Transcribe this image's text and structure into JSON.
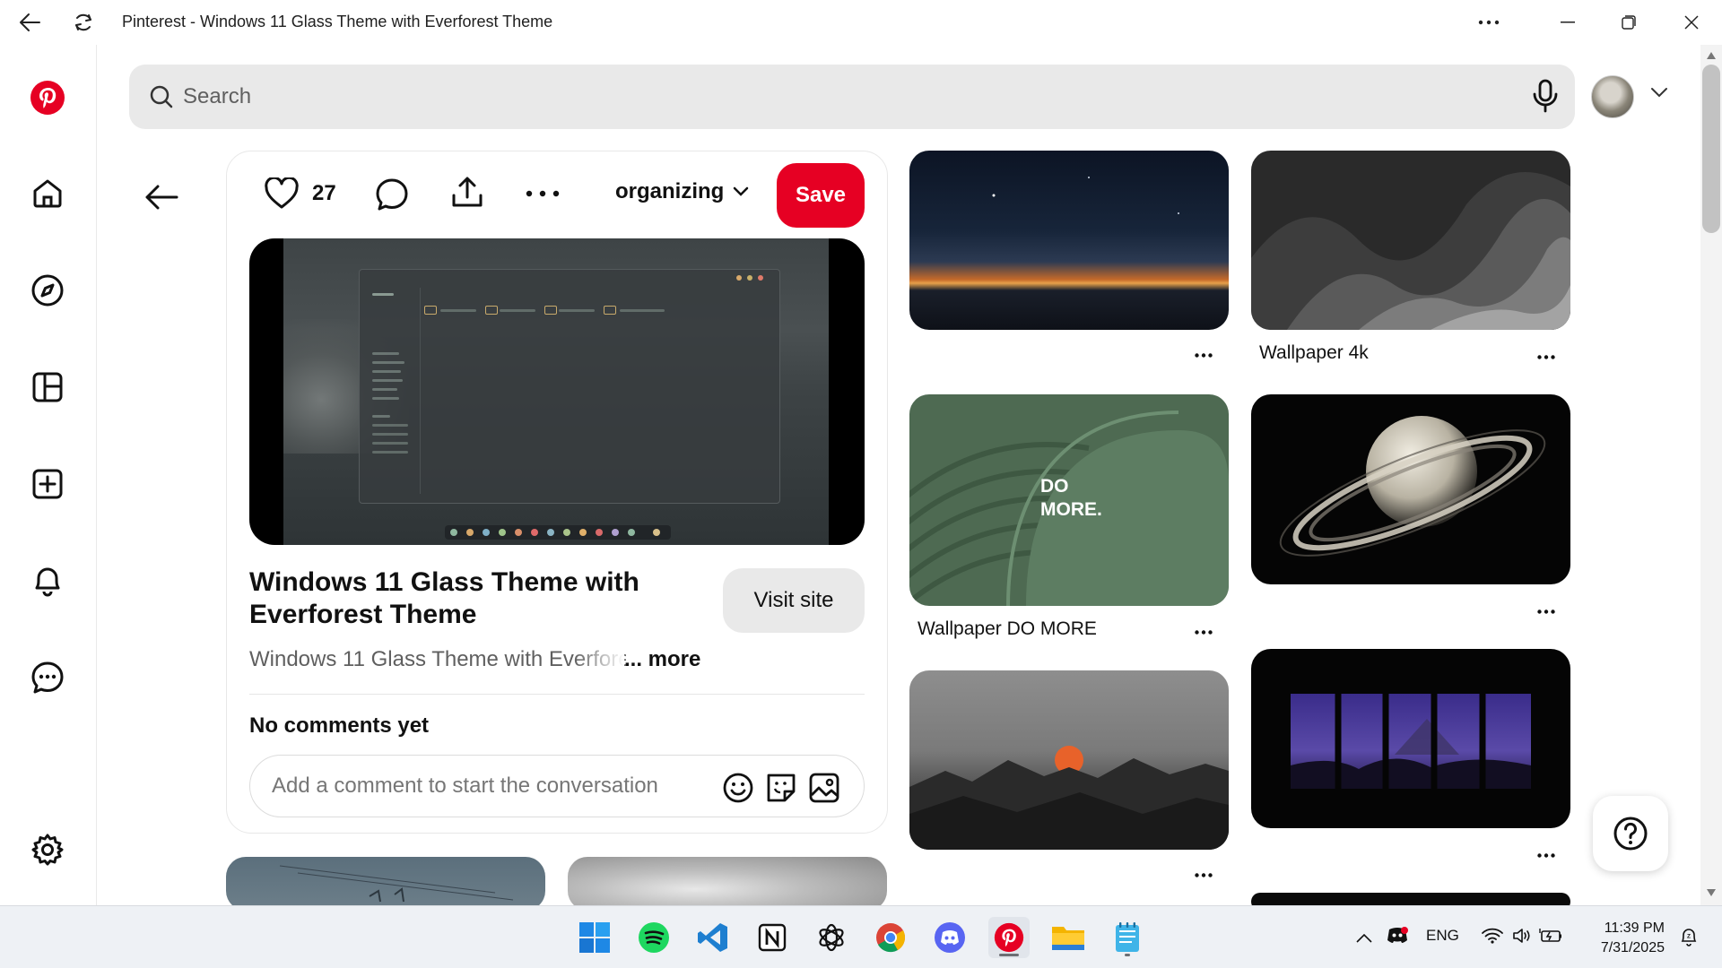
{
  "window": {
    "title": "Pinterest - Windows 11 Glass Theme with Everforest Theme"
  },
  "search": {
    "placeholder": "Search"
  },
  "pin": {
    "like_count": "27",
    "board": "organizing",
    "save_label": "Save",
    "title": "Windows 11 Glass Theme with Everforest Theme",
    "visit_label": "Visit site",
    "description": "Windows 11 Glass Theme with Everforest Theme",
    "more_label": "... more",
    "no_comments": "No comments yet",
    "comment_placeholder": "Add a comment to start the conversation"
  },
  "grid": {
    "tiles": [
      {
        "label": "",
        "kind": "horizon-sunset"
      },
      {
        "label": "Wallpaper 4k",
        "kind": "gray-waves"
      },
      {
        "label": "Wallpaper DO MORE",
        "kind": "green-do-more",
        "overlay": "DO MORE."
      },
      {
        "label": "",
        "kind": "saturn"
      },
      {
        "label": "",
        "kind": "sunset-mountains"
      },
      {
        "label": "",
        "kind": "purple-window"
      }
    ]
  },
  "taskbar": {
    "apps": [
      "windows-start",
      "spotify",
      "vscode",
      "notion",
      "chatgpt",
      "chrome",
      "discord",
      "pinterest",
      "file-explorer",
      "notepad"
    ],
    "language": "ENG",
    "time": "11:39 PM",
    "date": "7/31/2025"
  },
  "colors": {
    "brand": "#e60023",
    "search_bg": "#e9e9e9",
    "taskbar_bg": "#eef1f5"
  }
}
